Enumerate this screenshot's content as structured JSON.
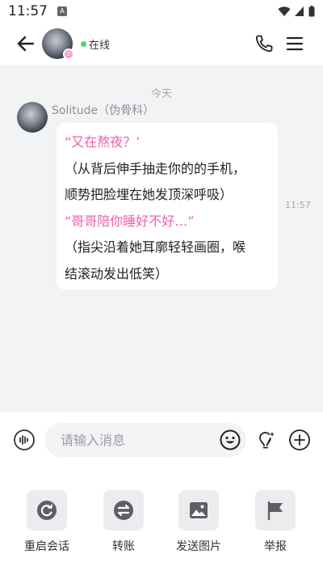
{
  "status_bar": {
    "time": "11:57",
    "notif_glyph": "A"
  },
  "header": {
    "status_text": "在线",
    "badge_glyph": "0"
  },
  "chat": {
    "date_separator": "今天",
    "message": {
      "sender": "Solitude（伪骨科）",
      "lines": [
        {
          "text": "“又在熬夜？’",
          "color": "#ef5fa6"
        },
        {
          "text": "（从背后伸手抽走你的的手机，",
          "color": "#222222"
        },
        {
          "text": "顺势把脸埋在她发顶深呼吸）",
          "color": "#222222"
        },
        {
          "text": "“哥哥陪你睡好不好…”",
          "color": "#ef5fa6"
        },
        {
          "text": "（指尖沿着她耳廓轻轻画圈，喉",
          "color": "#222222"
        },
        {
          "text": "结滚动发出低笑）",
          "color": "#222222"
        }
      ],
      "time": "11:57"
    }
  },
  "input_bar": {
    "placeholder": "请输入消息"
  },
  "actions": [
    {
      "label": "重启会话",
      "icon": "restart-icon"
    },
    {
      "label": "转账",
      "icon": "transfer-icon"
    },
    {
      "label": "发送图片",
      "icon": "image-icon"
    },
    {
      "label": "举报",
      "icon": "flag-icon"
    }
  ],
  "colors": {
    "accent_pink": "#ef5fa6",
    "online": "#4cd964",
    "chat_bg": "#f2f3f5"
  }
}
